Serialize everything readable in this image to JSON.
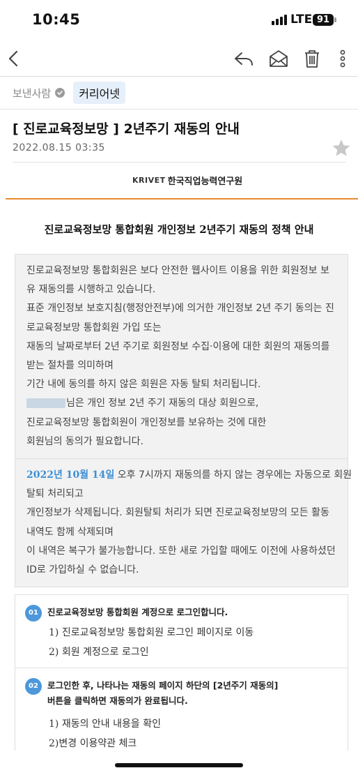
{
  "status_bar": {
    "time": "10:45",
    "network": "LTE",
    "battery": "91"
  },
  "toolbar": {
    "back_icon": "chevron-left-icon",
    "reply_icon": "reply-icon",
    "mark_unread_icon": "envelope-open-icon",
    "delete_icon": "trash-icon",
    "more_icon": "more-vertical-icon"
  },
  "email": {
    "sender_label": "보낸사람",
    "sender_name": "커리어넷",
    "subject": "[ 진로교육정보망 ] 2년주기 재동의 안내",
    "date": "2022.08.15 03:35"
  },
  "body": {
    "logo_brand": "KRIVET",
    "logo_name": "한국직업능력연구원",
    "title": "진로교육정보망 통합회원 개인정보 2년주기 재동의 정책 안내",
    "section1": [
      "진로교육정보망 통합회원은 보다 안전한 웹사이트 이용을 위한 회원정보 보",
      "유 재동의를 시행하고 있습니다.",
      "표준 개인정보 보호지침(행정안전부)에 의거한 개인정보 2년 주기 동의는 진",
      "로교육정보망 통합회원 가입 또는",
      "재동의 날짜로부터 2년 주기로 회원정보 수집·이용에 대한 회원의 재동의를",
      "받는 절차를 의미하며",
      "기간 내에 동의를 하지 않은 회원은 자동 탈퇴 처리됩니다."
    ],
    "section1_member_suffix": "님은 개인 정보 2년 주기 재동의 대상 회원으로,",
    "section1_tail": [
      "진로교육정보망 통합회원이 개인정보를 보유하는 것에 대한",
      "회원님의 동의가 필요합니다."
    ],
    "deadline_date": "2022년 10월 14일",
    "deadline_rest": " 오후 7시까지 재동의를 하지 않는 경우에는 자동으로 회원",
    "section2": [
      "탈퇴 처리되고",
      "개인정보가 삭제됩니다. 회원탈퇴 처리가 되면 진로교육정보망의 모든 활동",
      "내역도 함께 삭제되며",
      "이 내역은 복구가 불가능합니다. 또한 새로 가입할 때에도 이전에 사용하셨던",
      "ID로 가입하실 수 없습니다."
    ],
    "steps": [
      {
        "num": "01",
        "heading": [
          "진로교육정보망 통합회원 계정으로 로그인합니다."
        ],
        "items": [
          "1) 진로교육정보망 통합회원 로그인 페이지로 이동",
          "2) 회원 계정으로 로그인"
        ]
      },
      {
        "num": "02",
        "heading": [
          "로그인한 후, 나타나는 재동의 페이지 하단의 [2년주기 재동의]",
          "버튼을 클릭하면 재동의가 완료됩니다."
        ],
        "items": [
          "1) 재동의 안내 내용을 확인",
          "2)변경 이용약관 체크"
        ]
      }
    ]
  },
  "colors": {
    "accent_orange": "#e8892f",
    "highlight_blue": "#3c8fd6",
    "step_badge": "#4d97db",
    "sender_chip_bg": "#e6f0fb"
  }
}
